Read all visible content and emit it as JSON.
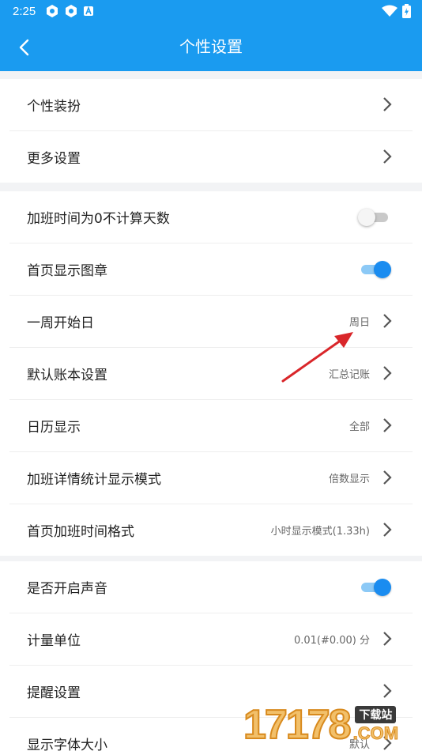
{
  "status": {
    "time": "2:25"
  },
  "header": {
    "title": "个性设置"
  },
  "groups": [
    {
      "items": [
        {
          "label": "个性装扮"
        },
        {
          "label": "更多设置"
        }
      ]
    },
    {
      "items": [
        {
          "label": "加班时间为0不计算天数",
          "toggle": "off"
        },
        {
          "label": "首页显示图章",
          "toggle": "on"
        },
        {
          "label": "一周开始日",
          "value": "周日"
        },
        {
          "label": "默认账本设置",
          "value": "汇总记账"
        },
        {
          "label": "日历显示",
          "value": "全部"
        },
        {
          "label": "加班详情统计显示模式",
          "value": "倍数显示"
        },
        {
          "label": "首页加班时间格式",
          "value": "小时显示模式(1.33h)"
        }
      ]
    },
    {
      "items": [
        {
          "label": "是否开启声音",
          "toggle": "on"
        },
        {
          "label": "计量单位",
          "value": "0.01(#0.00) 分"
        },
        {
          "label": "提醒设置"
        },
        {
          "label": "显示字体大小",
          "value": "默认"
        }
      ]
    }
  ],
  "watermark": {
    "number": "17178",
    "badge": "下载站",
    "suffix": ".COM"
  },
  "colors": {
    "primary": "#1a9bf0",
    "annotation_arrow": "#d9262a"
  }
}
